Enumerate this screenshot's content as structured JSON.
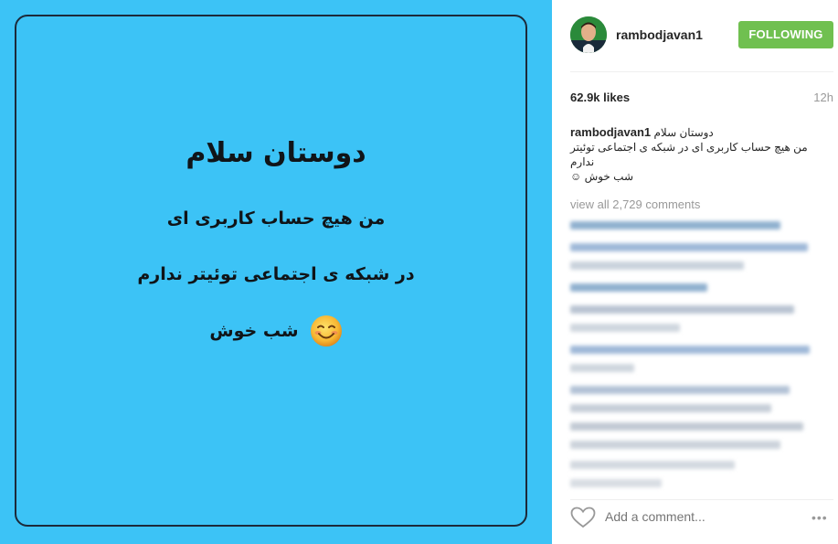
{
  "post_image": {
    "title": "دوستان سلام",
    "line2": "من هیچ حساب کاربری ای",
    "line3": "در شبکه ی اجتماعی توئیتر ندارم",
    "line4": "شب خوش",
    "emoji": "smiling-face-emoji",
    "background": "#3cc3f6"
  },
  "header": {
    "username": "rambodjavan1",
    "follow_label": "FOLLOWING",
    "follow_color": "#70c050"
  },
  "stats": {
    "likes": "62.9k likes",
    "time": "12h"
  },
  "caption": {
    "username": "rambodjavan1",
    "line1": "دوستان سلام",
    "line2": "من هیچ حساب کاربری ای در شبکه ی اجتماعی توئیتر",
    "line3": "ندارم",
    "line4": "شب خوش ☺"
  },
  "comments": {
    "view_all": "view all 2,729 comments"
  },
  "footer": {
    "add_comment_placeholder": "Add a comment...",
    "more_icon": "•••",
    "like_icon": "heart-icon"
  }
}
